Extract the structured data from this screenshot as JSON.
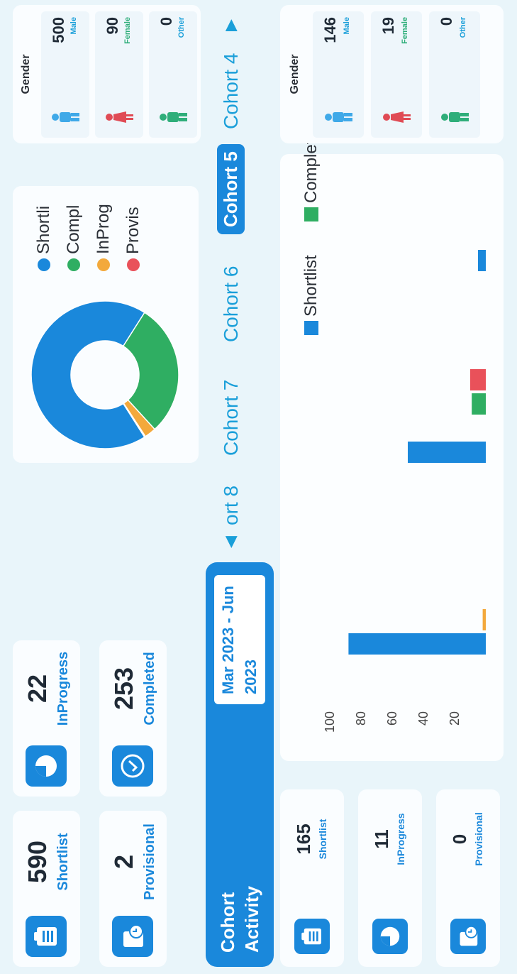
{
  "summary": {
    "shortlist": {
      "value": "590",
      "label": "Shortlist"
    },
    "provisional": {
      "value": "2",
      "label": "Provisional"
    },
    "inprogress": {
      "value": "22",
      "label": "InProgress"
    },
    "completed": {
      "value": "253",
      "label": "Completed"
    }
  },
  "donut": {
    "legend": [
      "Shortli",
      "Compl",
      "InProg",
      "Provis"
    ],
    "colors": [
      "#1a88db",
      "#2fae62",
      "#f3a93c",
      "#e9515a"
    ],
    "values": [
      590,
      253,
      22,
      2
    ]
  },
  "gender": {
    "title": "Gender",
    "rows": [
      {
        "value": "500",
        "label": "Male",
        "color": "#3fa9e8"
      },
      {
        "value": "90",
        "label": "Female",
        "color": "#e04b55"
      },
      {
        "value": "0",
        "label": "Other",
        "color": "#2fae7a"
      }
    ]
  },
  "cohort": {
    "title_line1": "Cohort",
    "title_line2": "Activity",
    "date_line1": "Mar 2023 - Jun",
    "date_line2": "2023",
    "tabs": [
      "◀",
      "ort 8",
      "Cohort 7",
      "Cohort 6",
      "Cohort 5",
      "Cohort 4",
      "▶"
    ],
    "active_tab": "Cohort 5"
  },
  "cohort_stats": {
    "shortlist": {
      "value": "165",
      "label": "Shortlist"
    },
    "inprogress": {
      "value": "11",
      "label": "InProgress"
    },
    "provisional": {
      "value": "0",
      "label": "Provisional"
    }
  },
  "cohort_gender": {
    "title": "Gender",
    "rows": [
      {
        "value": "146",
        "label": "Male"
      },
      {
        "value": "19",
        "label": "Female"
      },
      {
        "value": "0",
        "label": "Other"
      }
    ]
  },
  "chart_data": {
    "type": "bar",
    "legend": [
      "Shortlist",
      "Complete"
    ],
    "yticks": [
      "100",
      "80",
      "60",
      "40",
      "20"
    ],
    "ylim": [
      0,
      100
    ],
    "groups": [
      {
        "Shortlist": 88,
        "InProgress": 2,
        "Complete": 0,
        "Provisional": 0
      },
      {
        "Shortlist": 50,
        "InProgress": 0,
        "Complete": 9,
        "Provisional": 10
      },
      {
        "Shortlist": 5,
        "InProgress": 0,
        "Complete": 0,
        "Provisional": 0
      }
    ],
    "colors": {
      "Shortlist": "#1a88db",
      "InProgress": "#f3a93c",
      "Complete": "#2fae62",
      "Provisional": "#e9515a"
    }
  }
}
